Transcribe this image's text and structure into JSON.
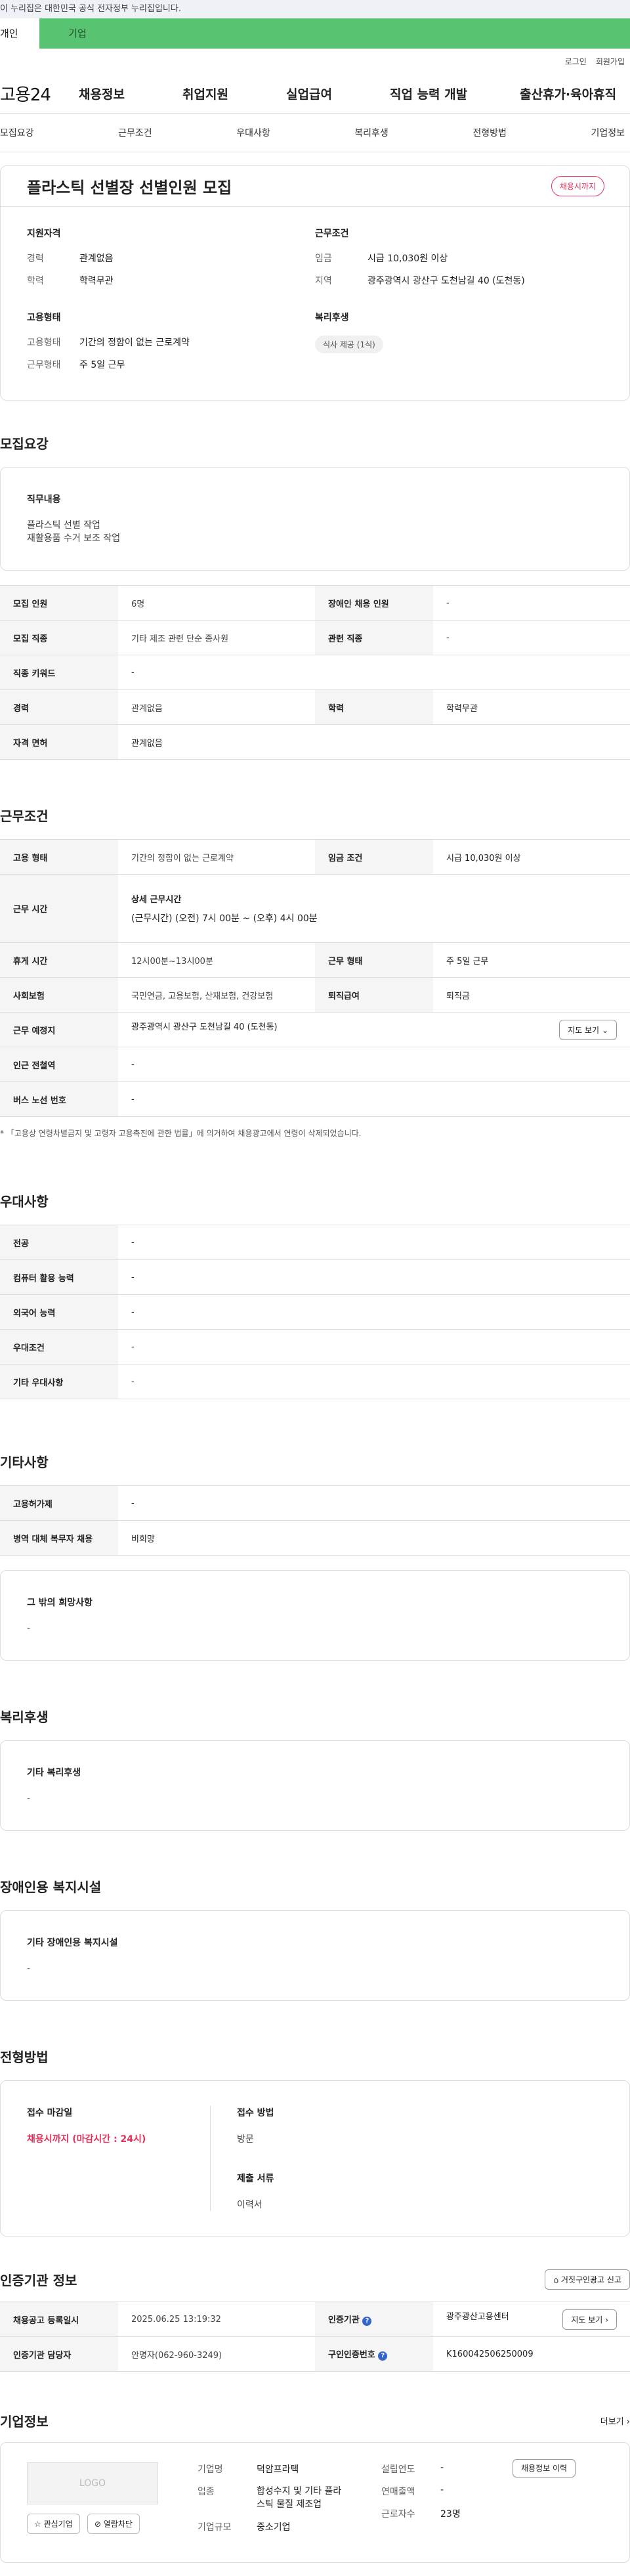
{
  "gov_banner": "이 누리집은 대한민국 공식 전자정부 누리집입니다.",
  "user_tabs": [
    "개인",
    "기업"
  ],
  "top_links": [
    "로그인",
    "회원가입"
  ],
  "gnb": {
    "logo": "고용24",
    "items": [
      "채용정보",
      "취업지원",
      "실업급여",
      "직업 능력 개발",
      "출산휴가·육아휴직"
    ]
  },
  "lnb": [
    "모집요강",
    "근무조건",
    "우대사항",
    "복리후생",
    "전형방법",
    "기업정보"
  ],
  "job": {
    "title": "플라스틱 선별장 선별인원 모집",
    "badge": "채용시까지",
    "qualify_title": "지원자격",
    "qualify": [
      {
        "k": "경력",
        "v": "관계없음"
      },
      {
        "k": "학력",
        "v": "학력무관"
      }
    ],
    "condition_title": "근무조건",
    "condition": [
      {
        "k": "임금",
        "v": "시급 10,030원 이상"
      },
      {
        "k": "지역",
        "v": "광주광역시 광산구 도천남길 40 (도천동)"
      }
    ],
    "employ_title": "고용형태",
    "employ": [
      {
        "k": "고용형태",
        "v": "기간의 정함이 없는 근로계약"
      },
      {
        "k": "근무형태",
        "v": "주 5일 근무"
      }
    ],
    "welfare_title": "복리후생",
    "welfare_chip": "식사 제공 (1식)"
  },
  "recruit": {
    "section_title": "모집요강",
    "duty_title": "직무내용",
    "duty_lines": [
      "플라스틱 선별 작업",
      "재활용품 수거 보조 작업"
    ],
    "rows": [
      [
        "모집 인원",
        "6명",
        "장애인 채용 인원",
        "-"
      ],
      [
        "모집 직종",
        "기타 제조 관련 단순 종사원",
        "관련 직종",
        "-"
      ],
      [
        "직종 키워드",
        "-"
      ],
      [
        "경력",
        "관계없음",
        "학력",
        "학력무관"
      ],
      [
        "자격 면허",
        "관계없음"
      ]
    ]
  },
  "work": {
    "section_title": "근무조건",
    "employ_type_label": "고용 형태",
    "employ_type": "기간의 정함이 없는 근로계약",
    "wage_label": "임금 조건",
    "wage": "시급 10,030원 이상",
    "hours_label": "근무 시간",
    "hours_sub": "상세 근무시간",
    "hours": "(근무시간) (오전) 7시 00분 ~ (오후) 4시 00분",
    "rest_label": "휴게 시간",
    "rest": "12시00분~13시00분",
    "form_label": "근무 형태",
    "form": "주 5일 근무",
    "insurance_label": "사회보험",
    "insurance": "국민연금, 고용보험, 산재보험, 건강보험",
    "severance_label": "퇴직급여",
    "severance": "퇴직금",
    "place_label": "근무 예정지",
    "place": "광주광역시 광산구 도천남길 40 (도천동)",
    "map_btn": "지도 보기",
    "station_label": "인근 전철역",
    "station": "-",
    "bus_label": "버스 노선 번호",
    "bus": "-",
    "note": "* 「고용상 연령차별금지 및 고령자 고용촉진에 관한 법률」에 의거하여 채용광고에서 연령이 삭제되었습니다."
  },
  "prefer": {
    "section_title": "우대사항",
    "rows": [
      [
        "전공",
        "-"
      ],
      [
        "컴퓨터 활용 능력",
        "-"
      ],
      [
        "외국어 능력",
        "-"
      ],
      [
        "우대조건",
        "-"
      ],
      [
        "기타 우대사항",
        "-"
      ]
    ]
  },
  "etc": {
    "section_title": "기타사항",
    "rows": [
      [
        "고용허가제",
        "-"
      ],
      [
        "병역 대체 복무자 채용",
        "비희망"
      ]
    ],
    "other_title": "그 밖의 희망사항",
    "other": "-"
  },
  "benefit": {
    "section_title": "복리후생",
    "box_title": "기타 복리후생",
    "box_value": "-"
  },
  "disabled": {
    "section_title": "장애인용 복지시설",
    "box_title": "기타 장애인용 복지시설",
    "box_value": "-"
  },
  "apply": {
    "section_title": "전형방법",
    "deadline_label": "접수 마감일",
    "deadline": "채용시까지 (마감시간 : 24시)",
    "method_label": "접수 방법",
    "method": "방문",
    "docs_label": "제출 서류",
    "docs": "이력서"
  },
  "cert": {
    "section_title": "인증기관 정보",
    "report_btn": "거짓구인광고 신고",
    "reg_date_label": "채용공고 등록일시",
    "reg_date": "2025.06.25 13:19:32",
    "org_label": "인증기관",
    "org": "광주광산고용센터",
    "map_btn": "지도 보기",
    "staff_label": "인증기관 담당자",
    "staff": "안명자(062-960-3249)",
    "no_label": "구인인증번호",
    "no": "K160042506250009"
  },
  "company": {
    "section_title": "기업정보",
    "more": "더보기",
    "logo": "LOGO",
    "fav_btn": "관심기업",
    "block_btn": "열람차단",
    "name_label": "기업명",
    "name": "덕암프라텍",
    "industry_label": "업종",
    "industry": "합성수지 및 기타 플라스틱 물질 제조업",
    "size_label": "기업규모",
    "size": "중소기업",
    "year_label": "설립연도",
    "year": "-",
    "sales_label": "연매출액",
    "sales": "-",
    "emp_label": "근로자수",
    "emp": "23명",
    "history_btn": "채용정보 이력"
  }
}
